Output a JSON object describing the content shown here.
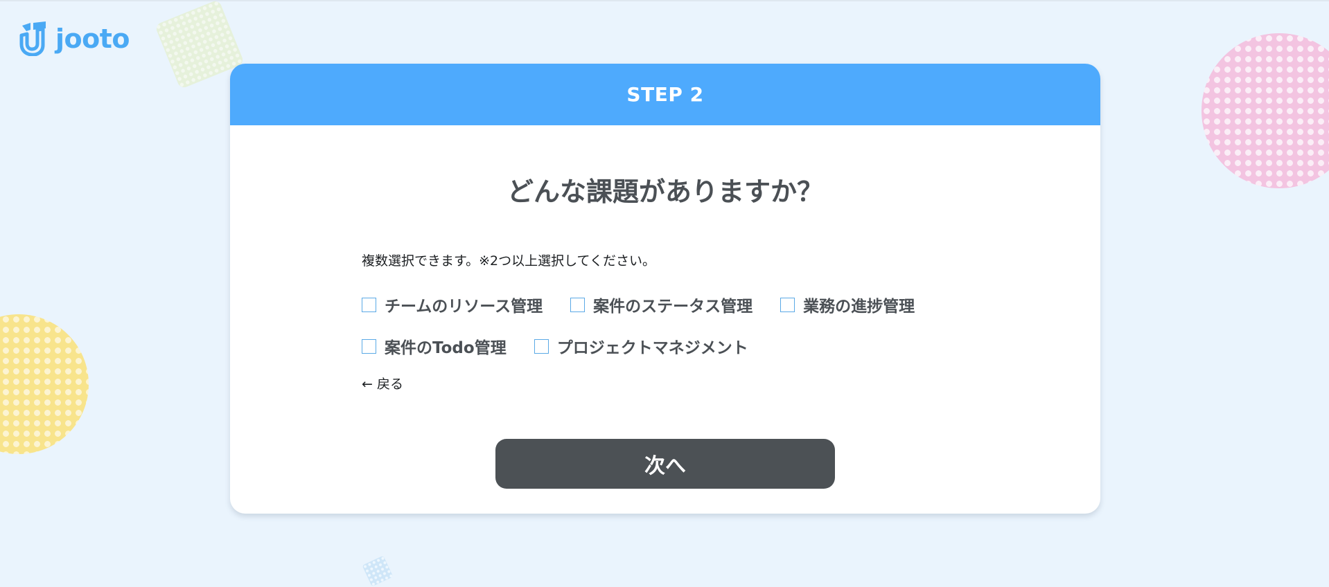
{
  "logo": {
    "text": "jooto"
  },
  "card": {
    "step_title": "STEP 2",
    "question": "どんな課題がありますか？",
    "hint": "複数選択できます。※2つ以上選択してください。",
    "options_row1": [
      {
        "label": "チームのリソース管理",
        "checked": false
      },
      {
        "label": "案件のステータス管理",
        "checked": false
      },
      {
        "label": "業務の進捗管理",
        "checked": false
      }
    ],
    "options_row2": [
      {
        "label": "案件のTodo管理",
        "checked": false
      },
      {
        "label": "プロジェクトマネジメント",
        "checked": false
      }
    ],
    "back_link": "← 戻る",
    "next_button": "次へ"
  },
  "colors": {
    "background": "#eaf4fd",
    "header": "#4eaafd",
    "brand": "#4aa9f4",
    "button": "#4c5155"
  },
  "icons": [
    "jooto-logo-icon",
    "checkbox-icon"
  ]
}
